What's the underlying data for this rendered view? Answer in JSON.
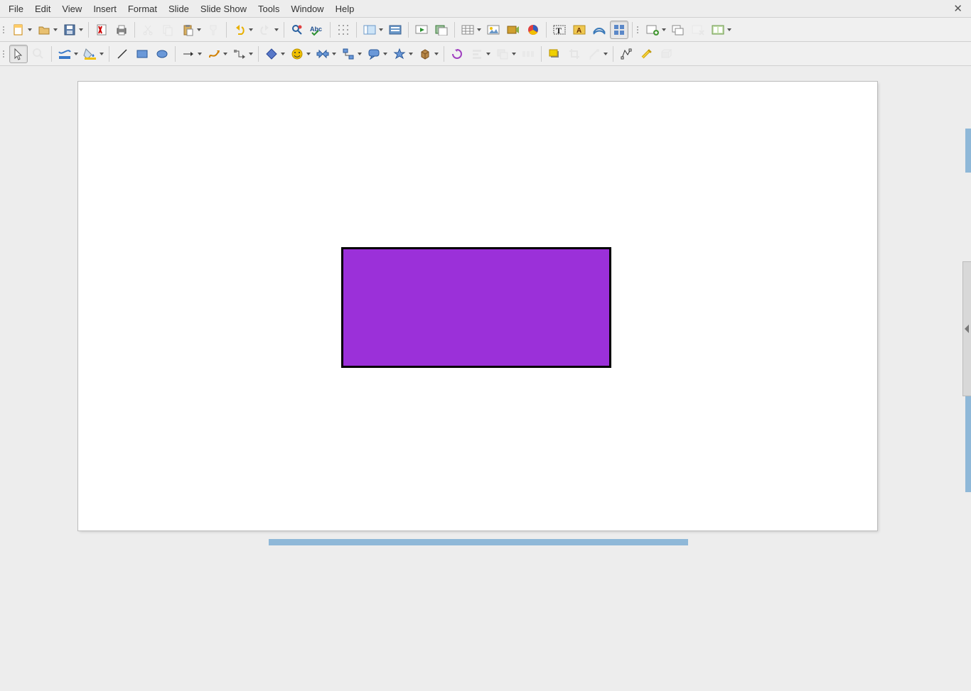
{
  "menu": {
    "items": [
      "File",
      "Edit",
      "View",
      "Insert",
      "Format",
      "Slide",
      "Slide Show",
      "Tools",
      "Window",
      "Help"
    ]
  },
  "shape": {
    "fill": "#9b30d9",
    "stroke": "#000000"
  },
  "toolbar1": {
    "new": "new-document",
    "open": "open-document",
    "save": "save-document",
    "pdf": "export-pdf",
    "print": "print",
    "cut": "cut",
    "copy": "copy",
    "paste": "paste",
    "clone": "clone-format",
    "undo": "undo",
    "redo": "redo",
    "find": "find-replace",
    "spell": "spellcheck",
    "grid": "display-grid",
    "views": "display-views",
    "master": "master-slide",
    "present": "start-presentation",
    "present2": "start-current",
    "table": "insert-table",
    "image": "insert-image",
    "av": "insert-av",
    "chart": "insert-chart",
    "textbox": "insert-textbox",
    "textboxv": "insert-vtext",
    "fontwork": "fontwork",
    "grid4": "snap-grid",
    "newslide": "new-slide",
    "dup": "dup-slide",
    "del": "delete-slide",
    "layout": "slide-layout"
  },
  "toolbar2": {
    "select": "select-tool",
    "zoom": "zoom-pan",
    "linecolor": "line-color",
    "fillcolor": "fill-color",
    "line": "insert-line",
    "rect": "rectangle",
    "ellipse": "ellipse",
    "arrow": "lines-arrows",
    "curve": "curves",
    "connector": "connectors",
    "diamond": "basic-shapes",
    "smiley": "symbol-shapes",
    "harrows": "block-arrows",
    "flow": "flowchart",
    "callout": "callouts",
    "star": "stars",
    "3d": "3d-objects",
    "rotate": "rotate",
    "alignh": "align",
    "arrange": "arrange",
    "distribute": "distribute",
    "shadow": "shadow",
    "crop": "crop",
    "filter": "filter",
    "poly": "polygon-edit",
    "glue": "gluepoints",
    "extrude": "extrusion"
  }
}
